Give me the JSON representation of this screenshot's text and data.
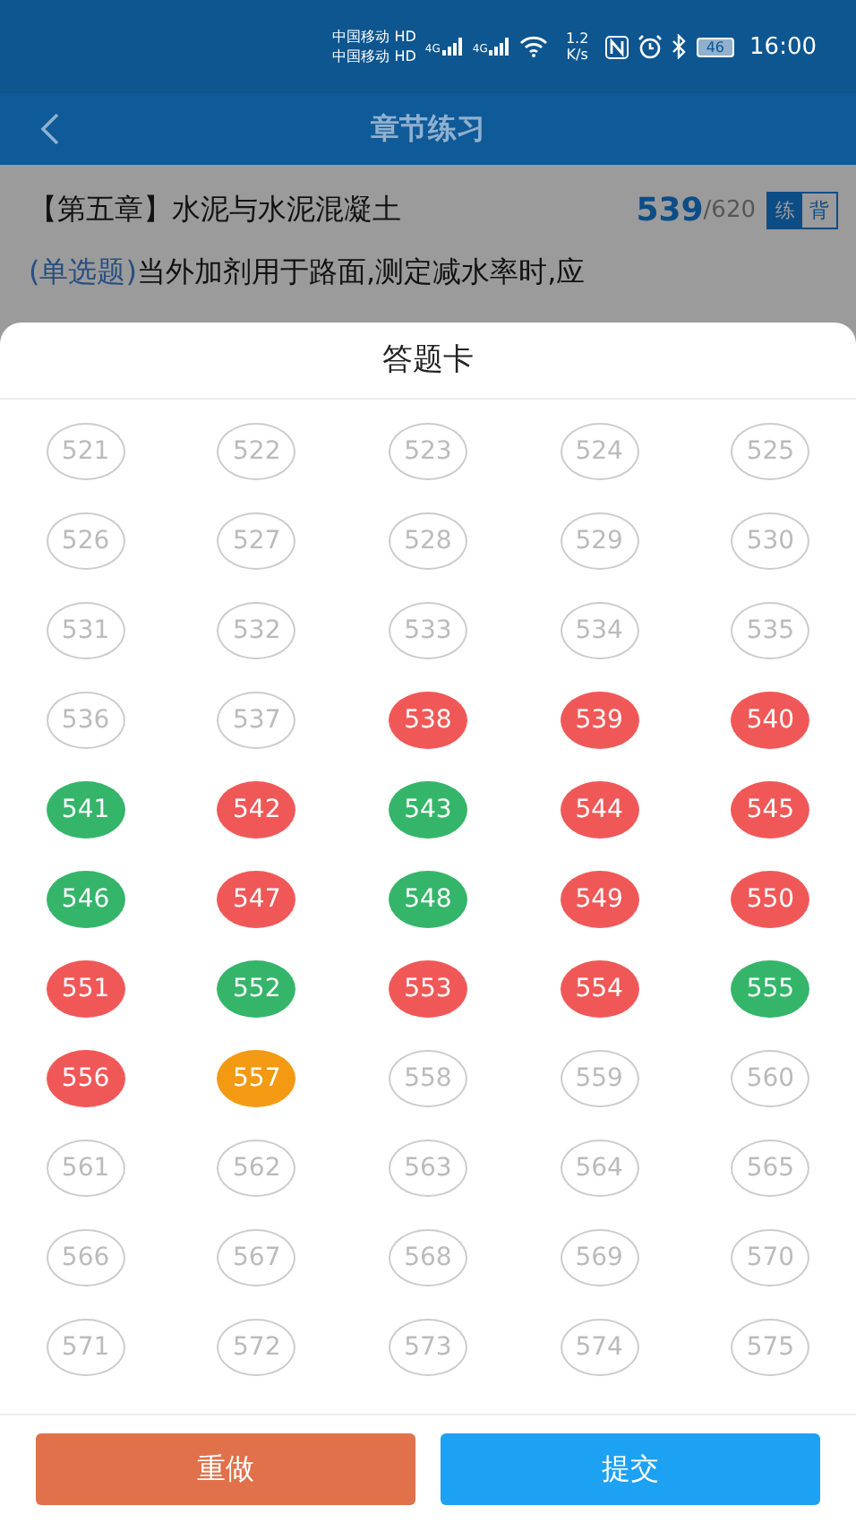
{
  "status_bar": {
    "carriers": [
      "中国移动 HD",
      "中国移动 HD"
    ],
    "network": [
      "4G",
      "4G"
    ],
    "speed": "1.2 K/s",
    "battery": "46",
    "time": "16:00"
  },
  "header": {
    "title": "章节练习"
  },
  "question": {
    "chapter": "【第五章】水泥与水泥混凝土",
    "current": "539",
    "total": "/620",
    "modes": [
      {
        "label": "练",
        "selected": true
      },
      {
        "label": "背",
        "selected": false
      }
    ],
    "type": "(单选题)",
    "text": "当外加剂用于路面,测定减水率时,应"
  },
  "answer_card": {
    "title": "答题卡",
    "items": [
      {
        "number": "521",
        "kind": "unanswered"
      },
      {
        "number": "522",
        "kind": "unanswered"
      },
      {
        "number": "523",
        "kind": "unanswered"
      },
      {
        "number": "524",
        "kind": "unanswered"
      },
      {
        "number": "525",
        "kind": "unanswered"
      },
      {
        "number": "526",
        "kind": "unanswered"
      },
      {
        "number": "527",
        "kind": "unanswered"
      },
      {
        "number": "528",
        "kind": "unanswered"
      },
      {
        "number": "529",
        "kind": "unanswered"
      },
      {
        "number": "530",
        "kind": "unanswered"
      },
      {
        "number": "531",
        "kind": "unanswered"
      },
      {
        "number": "532",
        "kind": "unanswered"
      },
      {
        "number": "533",
        "kind": "unanswered"
      },
      {
        "number": "534",
        "kind": "unanswered"
      },
      {
        "number": "535",
        "kind": "unanswered"
      },
      {
        "number": "536",
        "kind": "unanswered"
      },
      {
        "number": "537",
        "kind": "unanswered"
      },
      {
        "number": "538",
        "kind": "wrong"
      },
      {
        "number": "539",
        "kind": "wrong"
      },
      {
        "number": "540",
        "kind": "wrong"
      },
      {
        "number": "541",
        "kind": "correct"
      },
      {
        "number": "542",
        "kind": "wrong"
      },
      {
        "number": "543",
        "kind": "correct"
      },
      {
        "number": "544",
        "kind": "wrong"
      },
      {
        "number": "545",
        "kind": "wrong"
      },
      {
        "number": "546",
        "kind": "correct"
      },
      {
        "number": "547",
        "kind": "wrong"
      },
      {
        "number": "548",
        "kind": "correct"
      },
      {
        "number": "549",
        "kind": "wrong"
      },
      {
        "number": "550",
        "kind": "wrong"
      },
      {
        "number": "551",
        "kind": "wrong"
      },
      {
        "number": "552",
        "kind": "correct"
      },
      {
        "number": "553",
        "kind": "wrong"
      },
      {
        "number": "554",
        "kind": "wrong"
      },
      {
        "number": "555",
        "kind": "correct"
      },
      {
        "number": "556",
        "kind": "wrong"
      },
      {
        "number": "557",
        "kind": "current"
      },
      {
        "number": "558",
        "kind": "unanswered"
      },
      {
        "number": "559",
        "kind": "unanswered"
      },
      {
        "number": "560",
        "kind": "unanswered"
      },
      {
        "number": "561",
        "kind": "unanswered"
      },
      {
        "number": "562",
        "kind": "unanswered"
      },
      {
        "number": "563",
        "kind": "unanswered"
      },
      {
        "number": "564",
        "kind": "unanswered"
      },
      {
        "number": "565",
        "kind": "unanswered"
      },
      {
        "number": "566",
        "kind": "unanswered"
      },
      {
        "number": "567",
        "kind": "unanswered"
      },
      {
        "number": "568",
        "kind": "unanswered"
      },
      {
        "number": "569",
        "kind": "unanswered"
      },
      {
        "number": "570",
        "kind": "unanswered"
      },
      {
        "number": "571",
        "kind": "unanswered"
      },
      {
        "number": "572",
        "kind": "unanswered"
      },
      {
        "number": "573",
        "kind": "unanswered"
      },
      {
        "number": "574",
        "kind": "unanswered"
      },
      {
        "number": "575",
        "kind": "unanswered"
      }
    ]
  },
  "buttons": [
    {
      "label": "重做",
      "kind": "redo"
    },
    {
      "label": "提交",
      "kind": "submit"
    }
  ]
}
